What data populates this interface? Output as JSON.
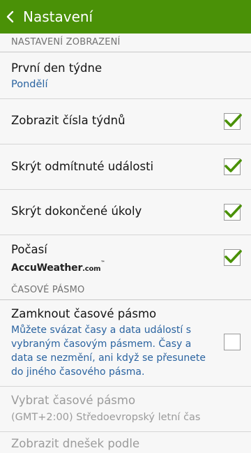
{
  "header": {
    "title": "Nastavení",
    "background": "#4a9107",
    "back_icon": "chevron-left-icon"
  },
  "sections": {
    "display": {
      "label": "NASTAVENÍ ZOBRAZENÍ"
    },
    "timezone": {
      "label": "ČASOVÉ PÁSMO"
    }
  },
  "settings": {
    "first_day": {
      "title": "První den týdne",
      "value": "Pondělí"
    },
    "week_numbers": {
      "title": "Zobrazit čísla týdnů",
      "checked": true
    },
    "hide_declined": {
      "title": "Skrýt odmítnuté události",
      "checked": true
    },
    "hide_completed": {
      "title": "Skrýt dokončené úkoly",
      "checked": true
    },
    "weather": {
      "title": "Počasí",
      "logo_main": "AccuWeather",
      "logo_suffix": ".com",
      "logo_tm": "™",
      "checked": true
    },
    "lock_timezone": {
      "title": "Zamknout časové pásmo",
      "description": "Můžete svázat časy a data událostí s vybraným časovým pásmem. Časy a data se nezmění, ani když se přesunete do jiného časového pásma.",
      "checked": false
    },
    "select_timezone": {
      "title": "Vybrat časové pásmo",
      "value": "(GMT+2:00) Středoevropský letní čas",
      "enabled": false
    },
    "show_today_by": {
      "title": "Zobrazit dnešek podle"
    }
  },
  "colors": {
    "check": "#4a9107",
    "link_text": "#2a63a0"
  }
}
